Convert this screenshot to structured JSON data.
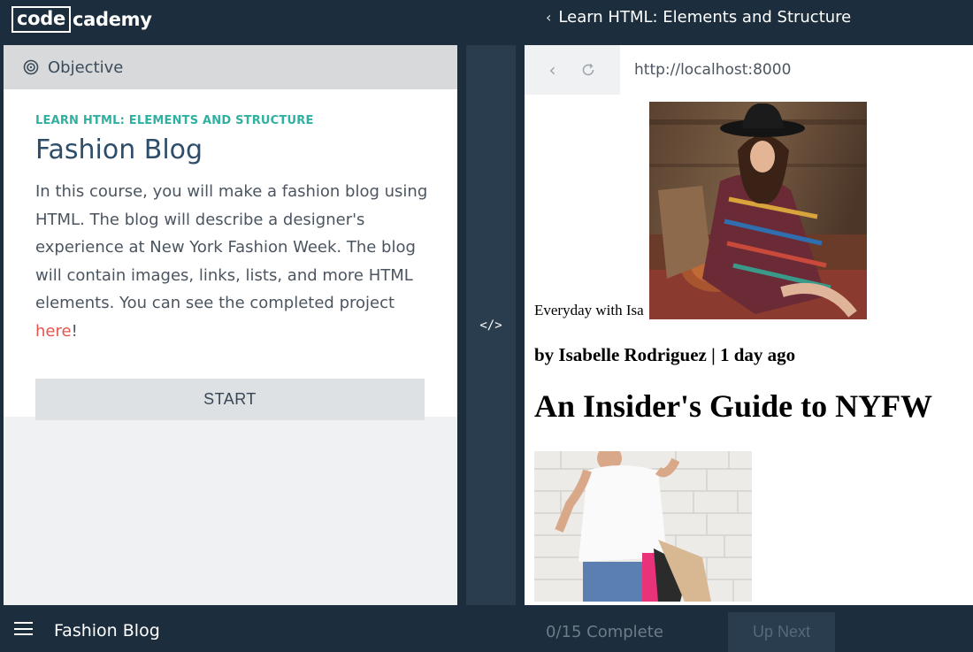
{
  "header": {
    "logo_box": "code",
    "logo_rest": "cademy",
    "course_link": "Learn HTML: Elements and Structure"
  },
  "objective": {
    "header_label": "Objective",
    "eyebrow": "LEARN HTML: ELEMENTS AND STRUCTURE",
    "title": "Fashion Blog",
    "description_before_link": "In this course, you will make a fashion blog using HTML. The blog will describe a designer's experience at New York Fashion Week. The blog will contain images, links, lists, and more HTML elements. You can see the completed project ",
    "link_text": "here",
    "description_after_link": "!",
    "start_label": "START"
  },
  "divider": {
    "icon_label": "</>"
  },
  "browser": {
    "url": "http://localhost:8000",
    "page": {
      "hero_caption": "Everyday with Isa",
      "byline": "by Isabelle Rodriguez | 1 day ago",
      "headline": "An Insider's Guide to NYFW"
    }
  },
  "footer": {
    "title": "Fashion Blog",
    "progress": "0/15 Complete",
    "up_next_label": "Up Next"
  },
  "colors": {
    "dark_bg": "#1c2d3d",
    "teal_accent": "#2fb0a0",
    "link_red": "#e8554e",
    "title_blue": "#2e4d6b"
  },
  "icons": [
    "objective-target-icon",
    "chevron-left-icon",
    "back-icon",
    "refresh-icon",
    "code-toggle-icon",
    "hamburger-menu-icon"
  ]
}
